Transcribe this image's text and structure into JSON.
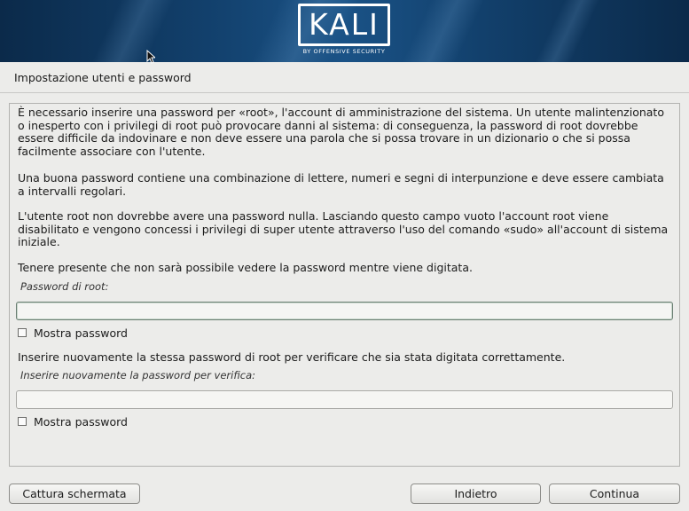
{
  "header": {
    "logo_text": "KALI",
    "logo_subtitle": "BY OFFENSIVE SECURITY"
  },
  "page": {
    "title": "Impostazione utenti e password"
  },
  "content": {
    "paragraphs": [
      "È necessario inserire una password per «root», l'account di amministrazione del sistema. Un utente malintenzionato o inesperto con i privilegi di root può provocare danni al sistema: di conseguenza, la password di root dovrebbe essere difficile da indovinare e non deve essere una parola che si possa trovare in un dizionario o che si possa facilmente associare con l'utente.",
      "Una buona password contiene una combinazione di lettere, numeri e segni di interpunzione e deve essere cambiata a intervalli regolari.",
      "L'utente root non dovrebbe avere una password nulla. Lasciando questo campo vuoto l'account root viene disabilitato e vengono concessi i privilegi di super utente attraverso l'uso del comando «sudo» all'account di sistema iniziale.",
      "Tenere presente che non sarà possibile vedere la password mentre viene digitata."
    ],
    "root_password": {
      "label": "Password di root:",
      "value": "",
      "show_label": "Mostra password",
      "show_checked": false
    },
    "verify_instruction": "Inserire nuovamente la stessa password di root per verificare che sia stata digitata correttamente.",
    "verify_password": {
      "label": "Inserire nuovamente la password per verifica:",
      "value": "",
      "show_label": "Mostra password",
      "show_checked": false
    }
  },
  "buttons": {
    "screenshot": "Cattura schermata",
    "back": "Indietro",
    "continue": "Continua"
  },
  "colors": {
    "banner_dark": "#0b2a4a",
    "banner_light": "#1a5286",
    "background": "#ececea",
    "focus_border": "#6b7f73"
  },
  "icons": {
    "cursor": "mouse-pointer-icon",
    "logo": "kali-logo"
  }
}
